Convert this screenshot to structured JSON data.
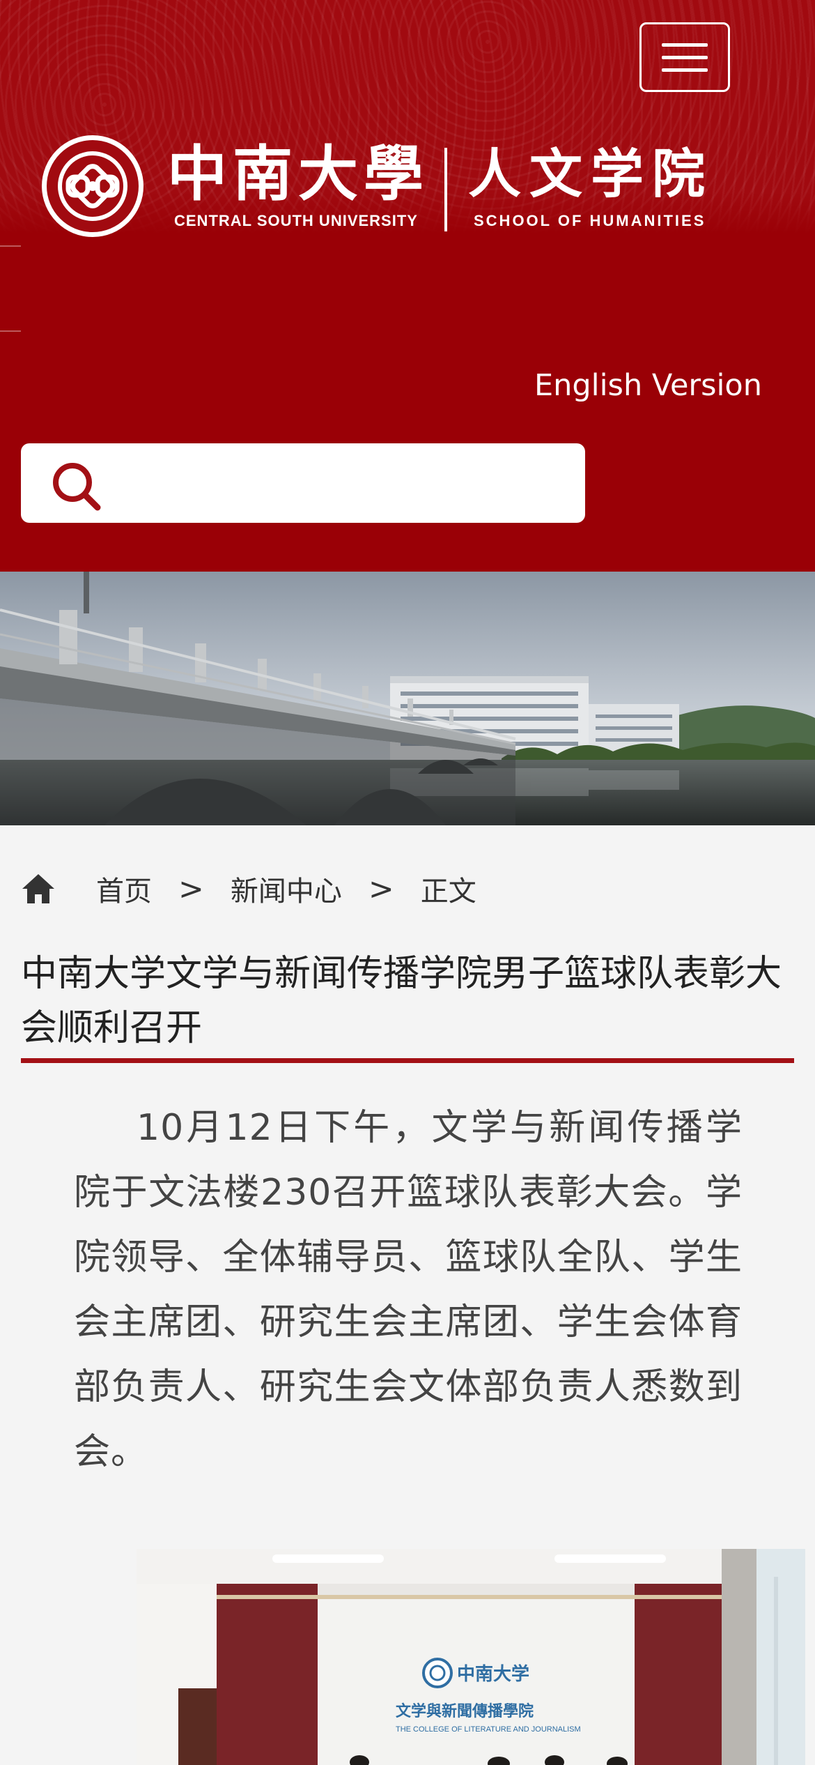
{
  "header": {
    "menu_button_label": "menu",
    "logo": {
      "university_cn": "中南大學",
      "university_en": "CENTRAL SOUTH UNIVERSITY",
      "school_cn": "人文学院",
      "school_en": "SCHOOL OF HUMANITIES"
    },
    "english_version_label": "English Version",
    "search": {
      "placeholder": "",
      "value": ""
    }
  },
  "breadcrumb": {
    "items": [
      "首页",
      "新闻中心",
      "正文"
    ],
    "separator": ">"
  },
  "article": {
    "title": "中南大学文学与新闻传播学院男子篮球队表彰大会顺利召开",
    "body": "10月12日下午，文学与新闻传播学院于文法楼230召开篮球队表彰大会。学院领导、全体辅导员、篮球队全队、学生会主席团、研究生会主席团、学生会体育部负责人、研究生会文体部负责人悉数到会。",
    "photo_sign": {
      "university_cn": "中南大学",
      "college_cn": "文学與新聞傳播學院",
      "college_en": "THE COLLEGE OF LITERATURE AND JOURNALISM"
    }
  },
  "colors": {
    "brand_red": "#9a0006",
    "title_rule": "#a31015",
    "page_bg": "#f4f4f4"
  }
}
